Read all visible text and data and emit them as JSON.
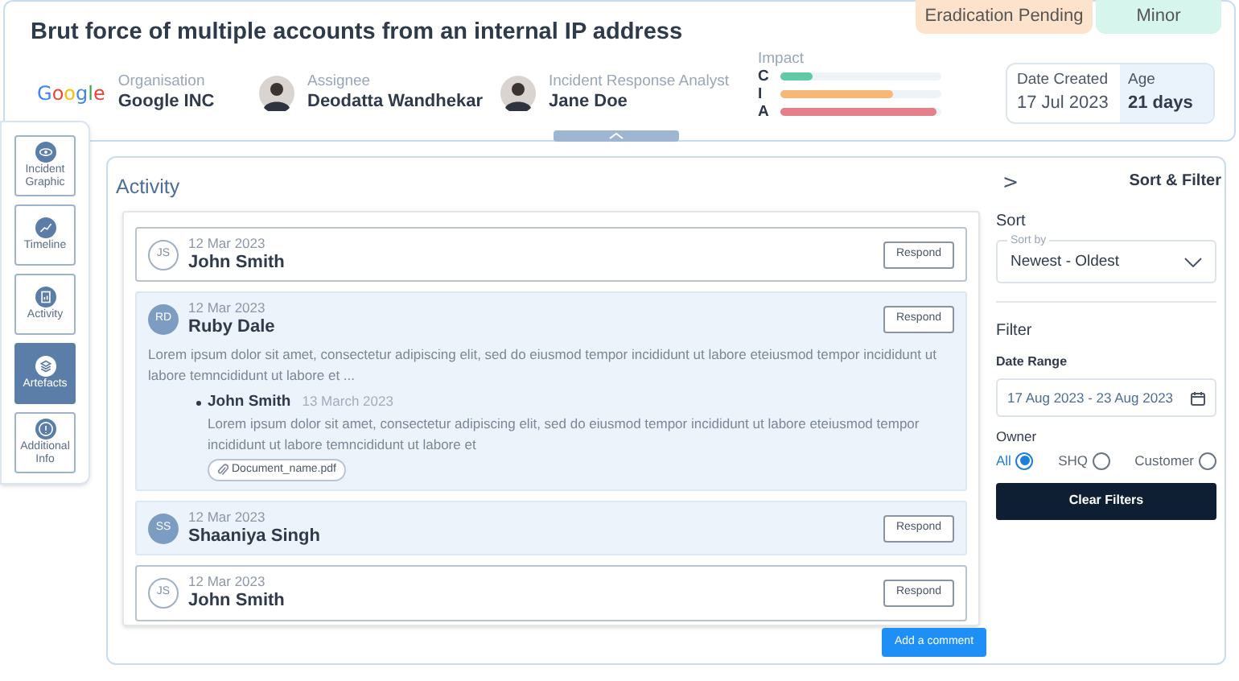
{
  "incident": {
    "title": "Brut force of multiple accounts from an internal IP address",
    "badges": [
      {
        "label": "Eradication Pending",
        "color": "#fde3cc"
      },
      {
        "label": "Minor",
        "color": "#d6f5ec"
      }
    ],
    "people": [
      {
        "kind": "logo",
        "logo": "Google",
        "label": "Organisation",
        "value": "Google INC"
      },
      {
        "kind": "avatar",
        "label": "Assignee",
        "value": "Deodatta Wandhekar"
      },
      {
        "kind": "avatar",
        "label": "Incident Response Analyst",
        "value": "Jane Doe"
      }
    ],
    "impact": {
      "label": "Impact",
      "bars": [
        {
          "letter": "C",
          "level": 0.2,
          "color": "#5fc9a8"
        },
        {
          "letter": "I",
          "level": 0.7,
          "color": "#f5b877"
        },
        {
          "letter": "A",
          "level": 0.97,
          "color": "#e4808a"
        }
      ]
    },
    "date_created": {
      "label": "Date Created",
      "value": "17 Jul 2023"
    },
    "age": {
      "label": "Age",
      "value": "21 days"
    }
  },
  "nav": [
    {
      "label": "Incident Graphic",
      "selected": false
    },
    {
      "label": "Timeline",
      "selected": false
    },
    {
      "label": "Activity",
      "selected": false
    },
    {
      "label": "Artefacts",
      "selected": true
    },
    {
      "label": "Additional Info",
      "selected": false
    }
  ],
  "activity": {
    "title": "Activity",
    "entries": [
      {
        "initials": "JS",
        "date": "12 Mar 2023",
        "name": "John Smith",
        "highlighted": false,
        "action": "Respond"
      },
      {
        "initials": "RD",
        "date": "12 Mar 2023",
        "name": "Ruby Dale",
        "highlighted": true,
        "action": "Respond",
        "body": "Lorem ipsum dolor sit amet, consectetur adipiscing elit, sed do eiusmod tempor incididunt ut labore eteiusmod tempor incididunt ut labore temncididunt ut labore et ...",
        "replies": [
          {
            "name": "John Smith",
            "date": "13 March 2023",
            "body": "Lorem ipsum dolor sit amet, consectetur adipiscing elit, sed do eiusmod tempor incididunt ut labore eteiusmod tempor incididunt ut labore temncididunt ut labore et",
            "attachment": "Document_name.pdf"
          }
        ]
      },
      {
        "initials": "SS",
        "date": "12 Mar 2023",
        "name": "Shaaniya Singh",
        "highlighted": true,
        "action": "Respond"
      },
      {
        "initials": "JS",
        "date": "12 Mar 2023",
        "name": "John Smith",
        "highlighted": false,
        "action": "Respond"
      }
    ],
    "add_button": "Add a comment"
  },
  "sort_filter": {
    "title": "Sort & Filter",
    "chevron": ">",
    "sort": {
      "heading": "Sort",
      "field_label": "Sort by",
      "value": "Newest - Oldest"
    },
    "filter": {
      "heading": "Filter",
      "date_label": "Date Range",
      "date_value": "17 Aug 2023 - 23 Aug 2023",
      "owner_label": "Owner",
      "owners": [
        {
          "label": "All",
          "selected": true
        },
        {
          "label": "SHQ",
          "selected": false
        },
        {
          "label": "Customer",
          "selected": false
        }
      ]
    },
    "clear_button": "Clear Filters"
  }
}
